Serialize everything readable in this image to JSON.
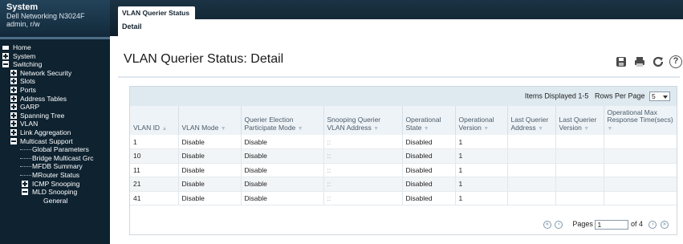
{
  "sidebar": {
    "title": "System",
    "device": "Dell Networking N3024F",
    "user": "admin, r/w",
    "tree": [
      {
        "label": "Home"
      },
      {
        "label": "System"
      },
      {
        "label": "Switching"
      },
      {
        "label": "Network Security"
      },
      {
        "label": "Slots"
      },
      {
        "label": "Ports"
      },
      {
        "label": "Address Tables"
      },
      {
        "label": "GARP"
      },
      {
        "label": "Spanning Tree"
      },
      {
        "label": "VLAN"
      },
      {
        "label": "Link Aggregation"
      },
      {
        "label": "Multicast Support"
      },
      {
        "label": "Global Parameters"
      },
      {
        "label": "Bridge Multicast Grc"
      },
      {
        "label": "MFDB Summary"
      },
      {
        "label": "MRouter Status"
      },
      {
        "label": "ICMP Snooping"
      },
      {
        "label": "MLD Snooping"
      },
      {
        "label": "General"
      }
    ]
  },
  "tabs": {
    "active": "VLAN Querier Status",
    "sub": "Detail"
  },
  "page": {
    "title": "VLAN Querier Status: Detail",
    "icons": [
      "save-icon",
      "print-icon",
      "refresh-icon",
      "help-icon"
    ]
  },
  "grid": {
    "items_displayed": "Items Displayed 1-5",
    "rows_per_page_label": "Rows Per Page",
    "rows_per_page_value": "5",
    "columns": [
      {
        "label": "VLAN ID",
        "sort": "▲"
      },
      {
        "label": "VLAN Mode",
        "sort": "▼"
      },
      {
        "label": "Querier Election Participate Mode",
        "sort": "▼"
      },
      {
        "label": "Snooping Querier VLAN Address",
        "sort": "▼"
      },
      {
        "label": "Operational State",
        "sort": "▼"
      },
      {
        "label": "Operational Version",
        "sort": "▼"
      },
      {
        "label": "Last Querier Address",
        "sort": "▼"
      },
      {
        "label": "Last Querier Version",
        "sort": "▼"
      },
      {
        "label": "Operational Max Response Time(secs)",
        "sort": "▼"
      }
    ],
    "rows": [
      [
        "1",
        "Disable",
        "Disable",
        "::",
        "Disabled",
        "1",
        "",
        "",
        ""
      ],
      [
        "10",
        "Disable",
        "Disable",
        "::",
        "Disabled",
        "1",
        "",
        "",
        ""
      ],
      [
        "11",
        "Disable",
        "Disable",
        "::",
        "Disabled",
        "1",
        "",
        "",
        ""
      ],
      [
        "21",
        "Disable",
        "Disable",
        "::",
        "Disabled",
        "1",
        "",
        "",
        ""
      ],
      [
        "41",
        "Disable",
        "Disable",
        "::",
        "Disabled",
        "1",
        "",
        "",
        ""
      ]
    ],
    "pager": {
      "pages_label": "Pages",
      "current": "1",
      "of_label": "of 4"
    }
  }
}
